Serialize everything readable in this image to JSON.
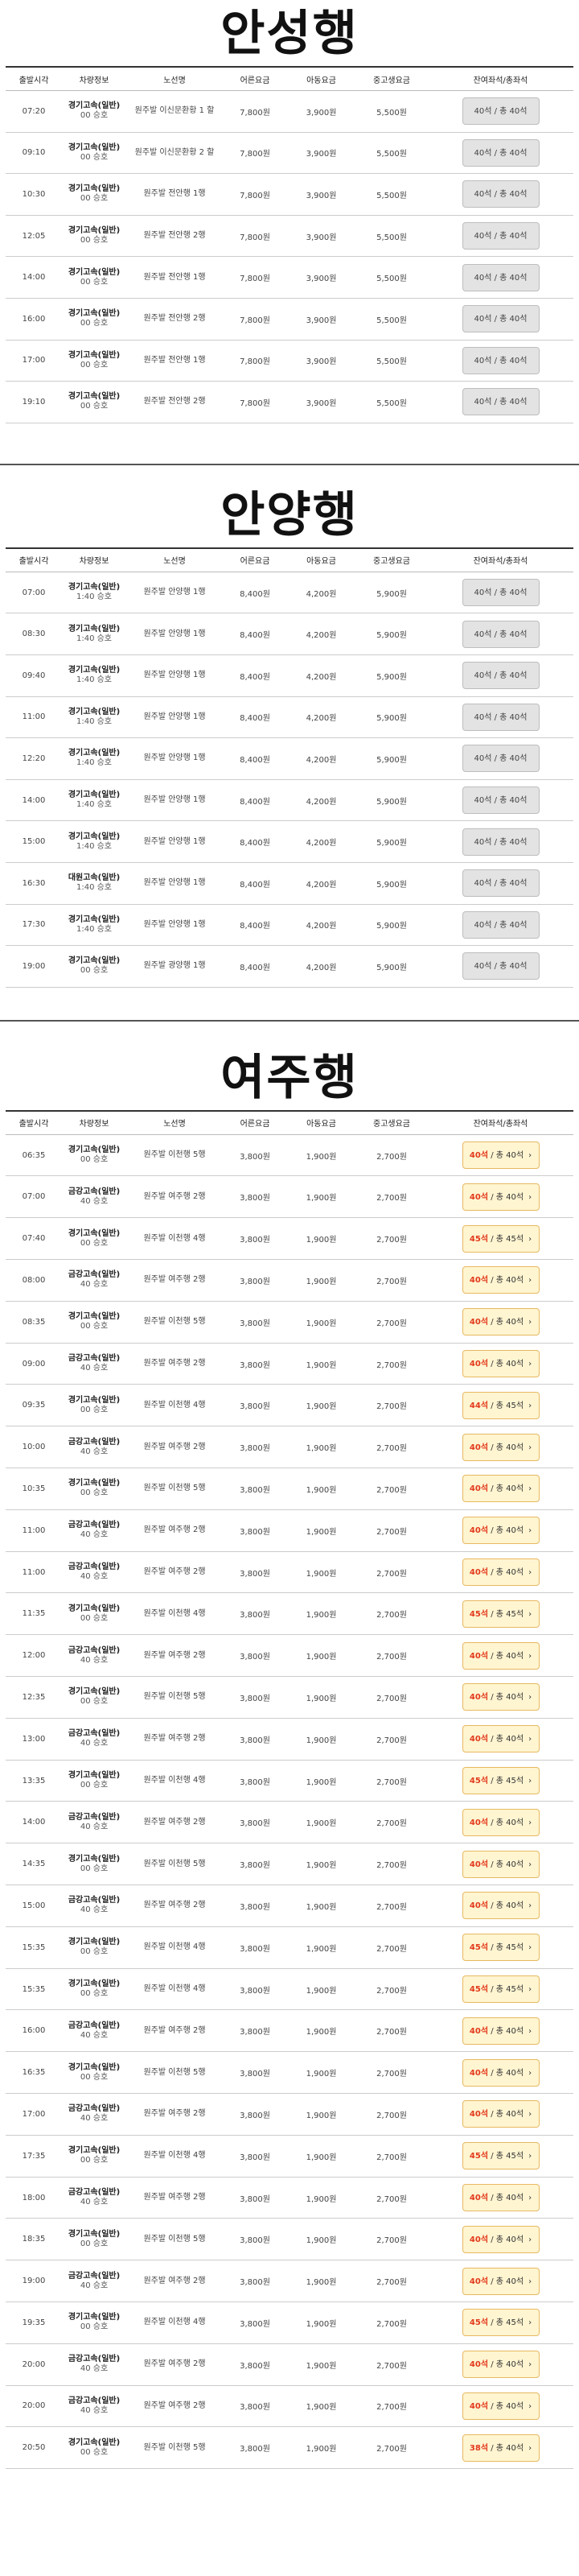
{
  "headers": [
    "출발시각",
    "차량정보",
    "노선명",
    "어른요금",
    "아동요금",
    "중고생요금",
    "잔여좌석/총좌석"
  ],
  "sections": [
    {
      "title": "안성행",
      "mode": "closed",
      "rows": [
        [
          "07:20",
          "경기고속(일반)",
          "00 승호",
          "원주발 이신문환황 1 할",
          "7,800원",
          "3,900원",
          "5,500원",
          "40석 / 총 40석"
        ],
        [
          "09:10",
          "경기고속(일반)",
          "00 승호",
          "원주발 이신문환황 2 할",
          "7,800원",
          "3,900원",
          "5,500원",
          "40석 / 총 40석"
        ],
        [
          "10:30",
          "경기고속(일반)",
          "00 승호",
          "원주발 전안행 1행",
          "7,800원",
          "3,900원",
          "5,500원",
          "40석 / 총 40석"
        ],
        [
          "12:05",
          "경기고속(일반)",
          "00 승호",
          "원주발 전안행 2행",
          "7,800원",
          "3,900원",
          "5,500원",
          "40석 / 총 40석"
        ],
        [
          "14:00",
          "경기고속(일반)",
          "00 승호",
          "원주발 전안행 1행",
          "7,800원",
          "3,900원",
          "5,500원",
          "40석 / 총 40석"
        ],
        [
          "16:00",
          "경기고속(일반)",
          "00 승호",
          "원주발 전안행 2행",
          "7,800원",
          "3,900원",
          "5,500원",
          "40석 / 총 40석"
        ],
        [
          "17:00",
          "경기고속(일반)",
          "00 승호",
          "원주발 전안행 1행",
          "7,800원",
          "3,900원",
          "5,500원",
          "40석 / 총 40석"
        ],
        [
          "19:10",
          "경기고속(일반)",
          "00 승호",
          "원주발 전안행 2행",
          "7,800원",
          "3,900원",
          "5,500원",
          "40석 / 총 40석"
        ]
      ]
    },
    {
      "title": "안양행",
      "mode": "closed",
      "rows": [
        [
          "07:00",
          "경기고속(일반)",
          "1:40 승호",
          "원주발 안양행 1행",
          "8,400원",
          "4,200원",
          "5,900원",
          "40석 / 총 40석"
        ],
        [
          "08:30",
          "경기고속(일반)",
          "1:40 승호",
          "원주발 안양행 1행",
          "8,400원",
          "4,200원",
          "5,900원",
          "40석 / 총 40석"
        ],
        [
          "09:40",
          "경기고속(일반)",
          "1:40 승호",
          "원주발 안양행 1행",
          "8,400원",
          "4,200원",
          "5,900원",
          "40석 / 총 40석"
        ],
        [
          "11:00",
          "경기고속(일반)",
          "1:40 승호",
          "원주발 안양행 1행",
          "8,400원",
          "4,200원",
          "5,900원",
          "40석 / 총 40석"
        ],
        [
          "12:20",
          "경기고속(일반)",
          "1:40 승호",
          "원주발 안양행 1행",
          "8,400원",
          "4,200원",
          "5,900원",
          "40석 / 총 40석"
        ],
        [
          "14:00",
          "경기고속(일반)",
          "1:40 승호",
          "원주발 안양행 1행",
          "8,400원",
          "4,200원",
          "5,900원",
          "40석 / 총 40석"
        ],
        [
          "15:00",
          "경기고속(일반)",
          "1:40 승호",
          "원주발 안양행 1행",
          "8,400원",
          "4,200원",
          "5,900원",
          "40석 / 총 40석"
        ],
        [
          "16:30",
          "대원고속(일반)",
          "1:40 승호",
          "원주발 안양행 1행",
          "8,400원",
          "4,200원",
          "5,900원",
          "40석 / 총 40석"
        ],
        [
          "17:30",
          "경기고속(일반)",
          "1:40 승호",
          "원주발 안양행 1행",
          "8,400원",
          "4,200원",
          "5,900원",
          "40석 / 총 40석"
        ],
        [
          "19:00",
          "경기고속(일반)",
          "00 승호",
          "원주발 광양행 1행",
          "8,400원",
          "4,200원",
          "5,900원",
          "40석 / 총 40석"
        ]
      ]
    },
    {
      "title": "여주행",
      "mode": "open",
      "rows": [
        [
          "06:35",
          "경기고속(일반)",
          "00 승호",
          "원주발 이천행 5행",
          "3,800원",
          "1,900원",
          "2,700원",
          "40석",
          "/ 총 40석"
        ],
        [
          "07:00",
          "금강고속(일반)",
          "40 승호",
          "원주발 여주행 2행",
          "3,800원",
          "1,900원",
          "2,700원",
          "40석",
          "/ 총 40석"
        ],
        [
          "07:40",
          "경기고속(일반)",
          "00 승호",
          "원주발 이천행 4행",
          "3,800원",
          "1,900원",
          "2,700원",
          "45석",
          "/ 총 45석"
        ],
        [
          "08:00",
          "금강고속(일반)",
          "40 승호",
          "원주발 여주행 2행",
          "3,800원",
          "1,900원",
          "2,700원",
          "40석",
          "/ 총 40석"
        ],
        [
          "08:35",
          "경기고속(일반)",
          "00 승호",
          "원주발 이천행 5행",
          "3,800원",
          "1,900원",
          "2,700원",
          "40석",
          "/ 총 40석"
        ],
        [
          "09:00",
          "금강고속(일반)",
          "40 승호",
          "원주발 여주행 2행",
          "3,800원",
          "1,900원",
          "2,700원",
          "40석",
          "/ 총 40석"
        ],
        [
          "09:35",
          "경기고속(일반)",
          "00 승호",
          "원주발 이천행 4행",
          "3,800원",
          "1,900원",
          "2,700원",
          "44석",
          "/ 총 45석"
        ],
        [
          "10:00",
          "금강고속(일반)",
          "40 승호",
          "원주발 여주행 2행",
          "3,800원",
          "1,900원",
          "2,700원",
          "40석",
          "/ 총 40석"
        ],
        [
          "10:35",
          "경기고속(일반)",
          "00 승호",
          "원주발 이천행 5행",
          "3,800원",
          "1,900원",
          "2,700원",
          "40석",
          "/ 총 40석"
        ],
        [
          "11:00",
          "금강고속(일반)",
          "40 승호",
          "원주발 여주행 2행",
          "3,800원",
          "1,900원",
          "2,700원",
          "40석",
          "/ 총 40석"
        ],
        [
          "11:00",
          "금강고속(일반)",
          "40 승호",
          "원주발 여주행 2행",
          "3,800원",
          "1,900원",
          "2,700원",
          "40석",
          "/ 총 40석"
        ],
        [
          "11:35",
          "경기고속(일반)",
          "00 승호",
          "원주발 이천행 4행",
          "3,800원",
          "1,900원",
          "2,700원",
          "45석",
          "/ 총 45석"
        ],
        [
          "12:00",
          "금강고속(일반)",
          "40 승호",
          "원주발 여주행 2행",
          "3,800원",
          "1,900원",
          "2,700원",
          "40석",
          "/ 총 40석"
        ],
        [
          "12:35",
          "경기고속(일반)",
          "00 승호",
          "원주발 이천행 5행",
          "3,800원",
          "1,900원",
          "2,700원",
          "40석",
          "/ 총 40석"
        ],
        [
          "13:00",
          "금강고속(일반)",
          "40 승호",
          "원주발 여주행 2행",
          "3,800원",
          "1,900원",
          "2,700원",
          "40석",
          "/ 총 40석"
        ],
        [
          "13:35",
          "경기고속(일반)",
          "00 승호",
          "원주발 이천행 4행",
          "3,800원",
          "1,900원",
          "2,700원",
          "45석",
          "/ 총 45석"
        ],
        [
          "14:00",
          "금강고속(일반)",
          "40 승호",
          "원주발 여주행 2행",
          "3,800원",
          "1,900원",
          "2,700원",
          "40석",
          "/ 총 40석"
        ],
        [
          "14:35",
          "경기고속(일반)",
          "00 승호",
          "원주발 이천행 5행",
          "3,800원",
          "1,900원",
          "2,700원",
          "40석",
          "/ 총 40석"
        ],
        [
          "15:00",
          "금강고속(일반)",
          "40 승호",
          "원주발 여주행 2행",
          "3,800원",
          "1,900원",
          "2,700원",
          "40석",
          "/ 총 40석"
        ],
        [
          "15:35",
          "경기고속(일반)",
          "00 승호",
          "원주발 이천행 4행",
          "3,800원",
          "1,900원",
          "2,700원",
          "45석",
          "/ 총 45석"
        ],
        [
          "15:35",
          "경기고속(일반)",
          "00 승호",
          "원주발 이천행 4행",
          "3,800원",
          "1,900원",
          "2,700원",
          "45석",
          "/ 총 45석"
        ],
        [
          "16:00",
          "금강고속(일반)",
          "40 승호",
          "원주발 여주행 2행",
          "3,800원",
          "1,900원",
          "2,700원",
          "40석",
          "/ 총 40석"
        ],
        [
          "16:35",
          "경기고속(일반)",
          "00 승호",
          "원주발 이천행 5행",
          "3,800원",
          "1,900원",
          "2,700원",
          "40석",
          "/ 총 40석"
        ],
        [
          "17:00",
          "금강고속(일반)",
          "40 승호",
          "원주발 여주행 2행",
          "3,800원",
          "1,900원",
          "2,700원",
          "40석",
          "/ 총 40석"
        ],
        [
          "17:35",
          "경기고속(일반)",
          "00 승호",
          "원주발 이천행 4행",
          "3,800원",
          "1,900원",
          "2,700원",
          "45석",
          "/ 총 45석"
        ],
        [
          "18:00",
          "금강고속(일반)",
          "40 승호",
          "원주발 여주행 2행",
          "3,800원",
          "1,900원",
          "2,700원",
          "40석",
          "/ 총 40석"
        ],
        [
          "18:35",
          "경기고속(일반)",
          "00 승호",
          "원주발 이천행 5행",
          "3,800원",
          "1,900원",
          "2,700원",
          "40석",
          "/ 총 40석"
        ],
        [
          "19:00",
          "금강고속(일반)",
          "40 승호",
          "원주발 여주행 2행",
          "3,800원",
          "1,900원",
          "2,700원",
          "40석",
          "/ 총 40석"
        ],
        [
          "19:35",
          "경기고속(일반)",
          "00 승호",
          "원주발 이천행 4행",
          "3,800원",
          "1,900원",
          "2,700원",
          "45석",
          "/ 총 45석"
        ],
        [
          "20:00",
          "금강고속(일반)",
          "40 승호",
          "원주발 여주행 2행",
          "3,800원",
          "1,900원",
          "2,700원",
          "40석",
          "/ 총 40석"
        ],
        [
          "20:00",
          "금강고속(일반)",
          "40 승호",
          "원주발 여주행 2행",
          "3,800원",
          "1,900원",
          "2,700원",
          "40석",
          "/ 총 40석"
        ],
        [
          "20:50",
          "경기고속(일반)",
          "00 승호",
          "원주발 이천행 5행",
          "3,800원",
          "1,900원",
          "2,700원",
          "38석",
          "/ 총 40석"
        ]
      ]
    }
  ]
}
